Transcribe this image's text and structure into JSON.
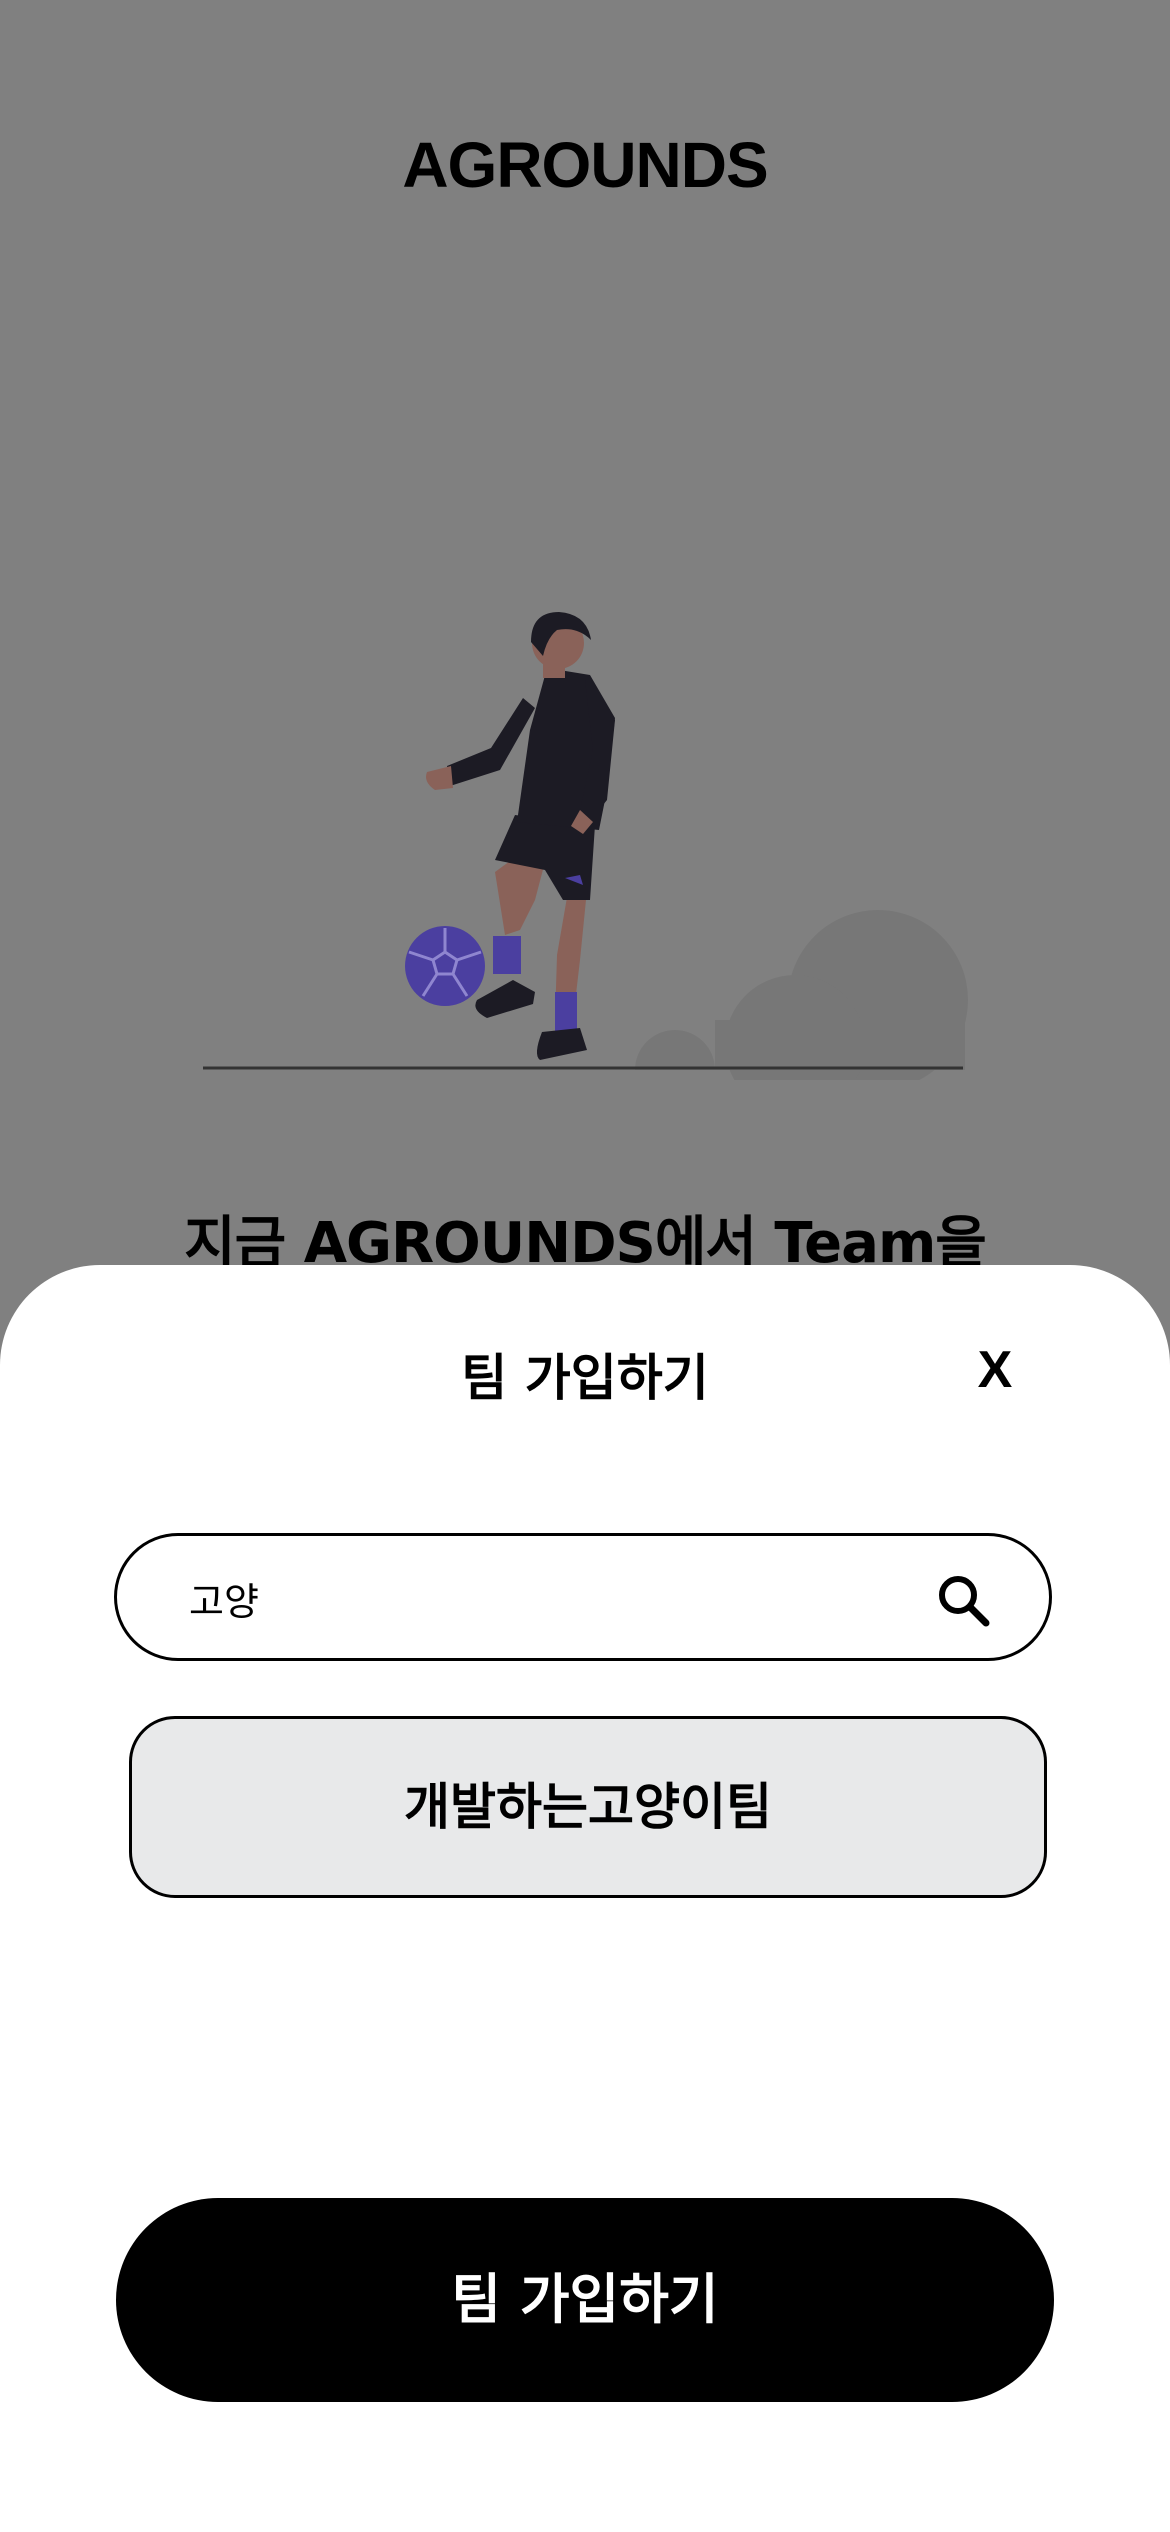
{
  "header": {
    "app_title": "AGROUNDS"
  },
  "hero": {
    "illustration": "soccer-player-illustration"
  },
  "tagline": "지금 AGROUNDS에서 Team을",
  "sheet": {
    "title": "팀 가입하기",
    "close_label": "X",
    "search": {
      "value": "고양",
      "icon": "search-icon"
    },
    "results": [
      {
        "label": "개발하는고양이팀"
      }
    ],
    "join_label": "팀 가입하기"
  },
  "colors": {
    "overlay": "#808080",
    "accent_purple": "#4b3fa0",
    "result_bg": "#e8e9ea",
    "button_bg": "#000000"
  }
}
